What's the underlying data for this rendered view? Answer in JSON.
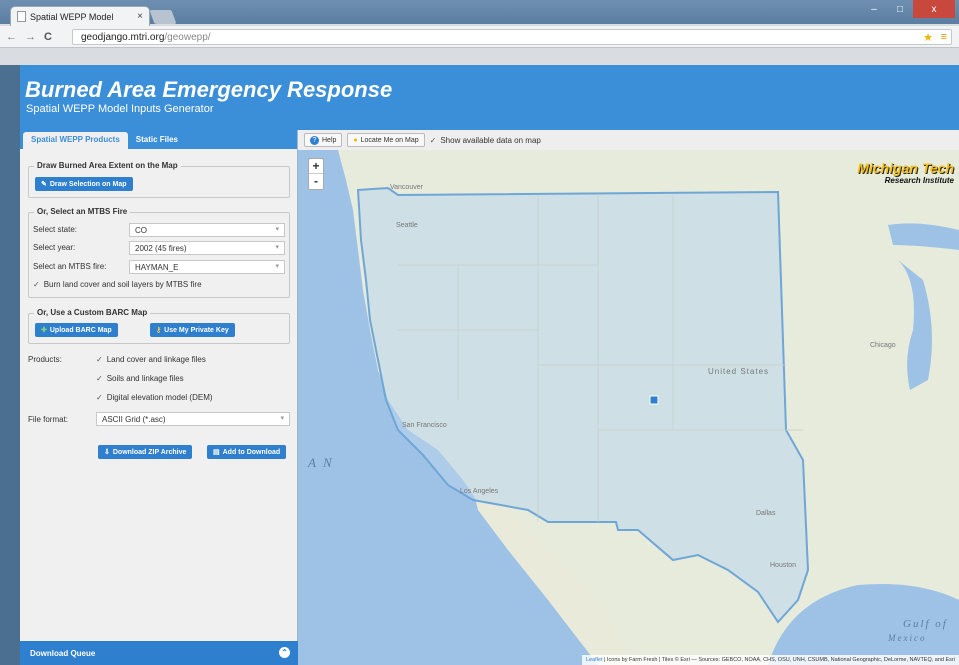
{
  "browser": {
    "tab_title": "Spatial WEPP Model",
    "tab_close": "×",
    "url_host": "geodjango.mtri.org",
    "url_path": "/geowepp/",
    "back": "←",
    "forward": "→",
    "reload": "C",
    "minimize": "–",
    "maximize": "□",
    "close": "x",
    "star": "★",
    "menu": "≡"
  },
  "header": {
    "title": "Burned Area Emergency Response",
    "subtitle": "Spatial WEPP Model Inputs Generator"
  },
  "panel": {
    "tabs": [
      {
        "label": "Spatial WEPP Products",
        "active": true
      },
      {
        "label": "Static Files",
        "active": false
      }
    ],
    "draw_section": {
      "legend": "Draw Burned Area Extent on the Map",
      "button": "Draw Selection on Map"
    },
    "mtbs_section": {
      "legend": "Or, Select an MTBS Fire",
      "state_label": "Select state:",
      "state_value": "CO",
      "year_label": "Select year:",
      "year_value": "2002 (45 fires)",
      "fire_label": "Select an MTBS fire:",
      "fire_value": "HAYMAN_E",
      "burn_check": "Burn land cover and soil layers by MTBS fire"
    },
    "barc_section": {
      "legend": "Or, Use a Custom BARC Map",
      "upload_button": "Upload BARC Map",
      "key_button": "Use My Private Key"
    },
    "products_label": "Products:",
    "products": [
      "Land cover and linkage files",
      "Soils and linkage files",
      "Digital elevation model (DEM)"
    ],
    "format_label": "File format:",
    "format_value": "ASCII Grid (*.asc)",
    "download_zip": "Download ZIP Archive",
    "add_download": "Add to Download",
    "queue": "Download Queue"
  },
  "map": {
    "help": "Help",
    "locate": "Locate Me on Map",
    "show_data": "Show available data on map",
    "zoom_in": "+",
    "zoom_out": "-",
    "logo_line1": "Michigan Tech",
    "logo_line2": "Research Institute",
    "labels": {
      "vancouver": "Vancouver",
      "seattle": "Seattle",
      "chicago": "Chicago",
      "united_states": "United States",
      "san_francisco": "San Francisco",
      "los_angeles": "Los Angeles",
      "dallas": "Dallas",
      "houston": "Houston",
      "ocean_fragment": "A N",
      "gulf": "Gulf of",
      "mexico": "Mexico"
    },
    "attribution_link": "Leaflet",
    "attribution_text": " | Icons by Farm Fresh | Tiles © Esri — Sources: GEBCO, NOAA, CHS, OSU, UNH, CSUMB, National Geographic, DeLorme, NAVTEQ, and Esri"
  },
  "colors": {
    "brand_blue": "#3b8ed8",
    "button_blue": "#2f7fcf",
    "ocean": "#9ec2e6",
    "land": "#e8ecdd",
    "overlay": "#b9d5ec"
  }
}
